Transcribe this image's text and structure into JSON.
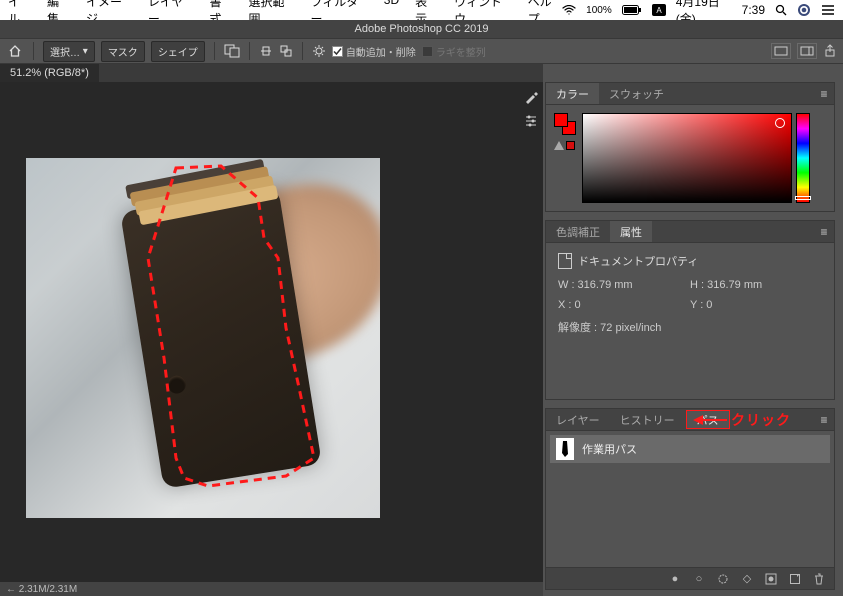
{
  "menubar": {
    "items": [
      "イル",
      "編集",
      "イメージ",
      "レイヤー",
      "書式",
      "選択範囲",
      "フィルター",
      "3D",
      "表示",
      "ウィンドウ",
      "ヘルプ"
    ],
    "battery": "100%",
    "date": "4月19日(金)",
    "time": "7:39"
  },
  "titlebar": {
    "title": "Adobe Photoshop CC 2019"
  },
  "optionsbar": {
    "select_label": "選択…",
    "mask_label": "マスク",
    "shape_label": "シェイプ",
    "auto_label": "自動追加・削除",
    "ragi_label": "ラギを整列",
    "dropdown_arrow": "▾"
  },
  "doctab": {
    "label": "51.2% (RGB/8*)"
  },
  "color_panel": {
    "tabs": [
      "カラー",
      "スウォッチ"
    ]
  },
  "props_panel": {
    "tabs": [
      "色調補正",
      "属性"
    ],
    "title": "ドキュメントプロパティ",
    "w_label": "W : 316.79 mm",
    "h_label": "H : 316.79 mm",
    "x_label": "X : 0",
    "y_label": "Y : 0",
    "res_label": "解像度 : 72 pixel/inch"
  },
  "paths_panel": {
    "tabs": [
      "レイヤー",
      "ヒストリー",
      "パス"
    ],
    "item_label": "作業用パス"
  },
  "annotation": {
    "click_label": "クリック"
  },
  "statusbar": {
    "text": "← 2.31M/2.31M"
  }
}
